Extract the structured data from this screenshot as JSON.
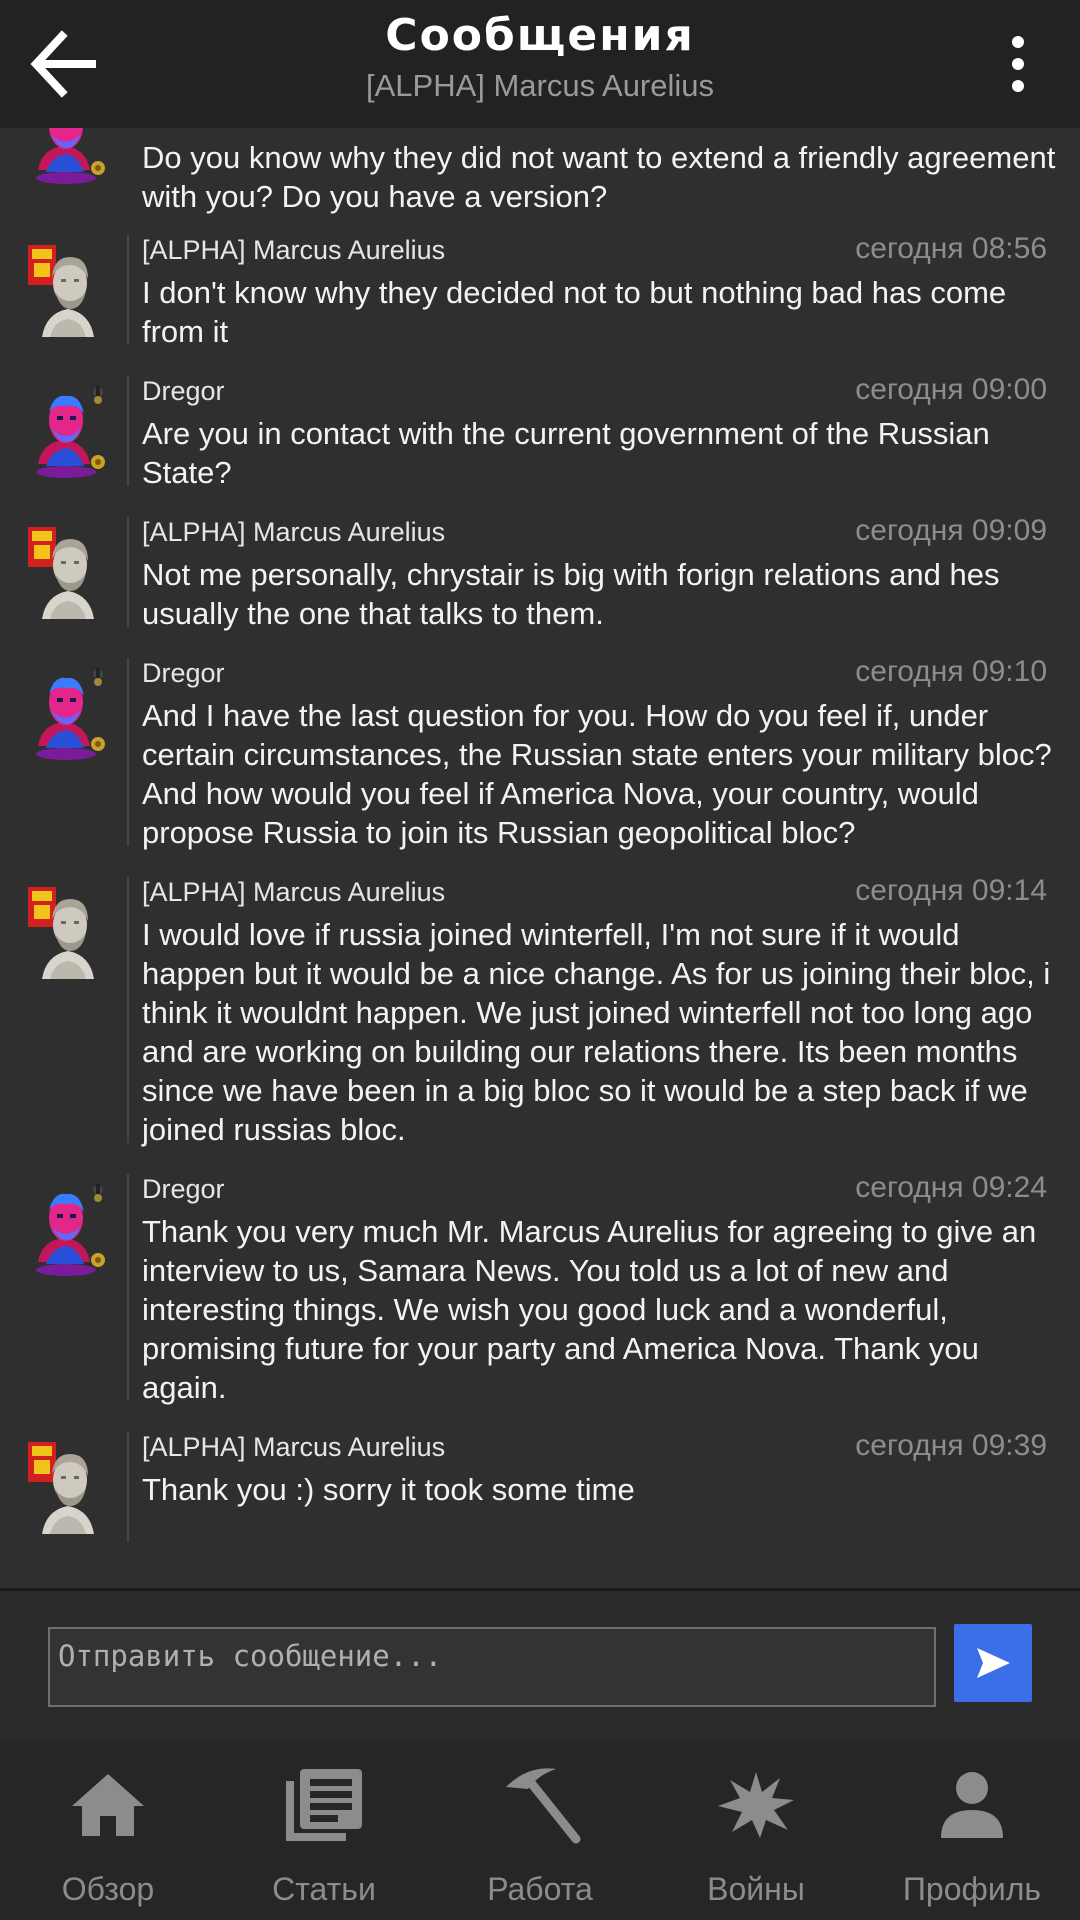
{
  "header": {
    "title": "Сообщения",
    "subtitle": "[ALPHA] Marcus Aurelius"
  },
  "messages": [
    {
      "author": "",
      "time": "",
      "avatar": "dregor-avatar",
      "text": "Do you know why they did not want to extend a friendly agreement with you? Do you have a version?"
    },
    {
      "author": "[ALPHA] Marcus Aurelius",
      "time": "сегодня 08:56",
      "avatar": "marcus-avatar",
      "text": "I don't know why they decided not to but nothing bad has come from it"
    },
    {
      "author": "Dregor",
      "time": "сегодня 09:00",
      "avatar": "dregor-avatar",
      "text": "Are you in contact with the current government of the Russian State?"
    },
    {
      "author": "[ALPHA] Marcus Aurelius",
      "time": "сегодня 09:09",
      "avatar": "marcus-avatar",
      "text": "Not me personally, chrystair is big with forign relations and hes usually the one that talks to them."
    },
    {
      "author": "Dregor",
      "time": "сегодня 09:10",
      "avatar": "dregor-avatar",
      "text": "And I have the last question for you. How do you feel if, under certain circumstances, the Russian state enters your military bloc? And how would you feel if America Nova, your country, would propose Russia to join its Russian geopolitical bloc?"
    },
    {
      "author": "[ALPHA] Marcus Aurelius",
      "time": "сегодня 09:14",
      "avatar": "marcus-avatar",
      "text": "I would love if russia joined winterfell, I'm not sure if it would happen but it would be a nice change. As for us joining their bloc, i think it wouldnt happen. We just joined winterfell not too long ago and are working on building our relations there. Its been months since we have been in a big bloc so it would be a step back if we joined russias bloc."
    },
    {
      "author": "Dregor",
      "time": "сегодня 09:24",
      "avatar": "dregor-avatar",
      "text": "Thank you very much Mr. Marcus Aurelius for agreeing to give an interview to us, Samara News. You told us a lot of new and interesting things. We wish you good luck and a wonderful, promising future for your party and America Nova. Thank you again."
    },
    {
      "author": "[ALPHA] Marcus Aurelius",
      "time": "сегодня 09:39",
      "avatar": "marcus-avatar",
      "text": "Thank you :) sorry it took some time"
    }
  ],
  "composer": {
    "placeholder": "Отправить сообщение...",
    "value": ""
  },
  "nav": [
    {
      "label": "Обзор",
      "icon": "home-icon"
    },
    {
      "label": "Статьи",
      "icon": "articles-icon"
    },
    {
      "label": "Работа",
      "icon": "pickaxe-icon"
    },
    {
      "label": "Войны",
      "icon": "explosion-icon"
    },
    {
      "label": "Профиль",
      "icon": "profile-icon"
    }
  ],
  "colors": {
    "background": "#2f2f2f",
    "header": "#222222",
    "send_button": "#3a6fe8",
    "nav_bar": "#262626"
  }
}
